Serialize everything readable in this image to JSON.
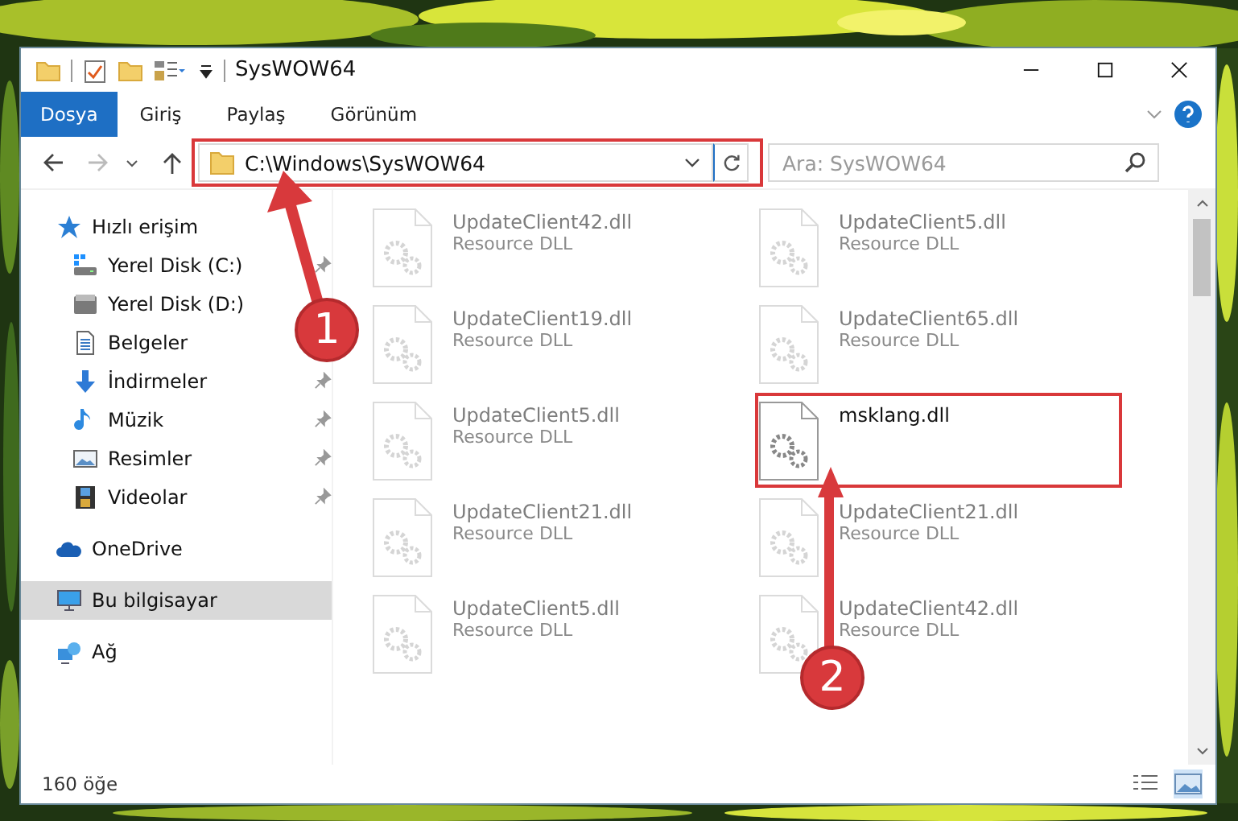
{
  "window": {
    "title": "SysWOW64"
  },
  "ribbon_tabs": [
    {
      "label": "Dosya",
      "selected": true
    },
    {
      "label": "Giriş",
      "selected": false
    },
    {
      "label": "Paylaş",
      "selected": false
    },
    {
      "label": "Görünüm",
      "selected": false
    }
  ],
  "address_bar": {
    "path": "C:\\Windows\\SysWOW64"
  },
  "search": {
    "placeholder": "Ara: SysWOW64"
  },
  "sidebar": {
    "items": [
      {
        "label": "Hızlı erişim",
        "kind": "star",
        "selected": false,
        "children": [
          {
            "label": "Yerel Disk (C:)",
            "kind": "windows-drive",
            "selected": false,
            "pinned": true
          },
          {
            "label": "Yerel Disk (D:)",
            "kind": "drive",
            "selected": false
          },
          {
            "label": "Belgeler",
            "kind": "documents",
            "selected": false
          },
          {
            "label": "İndirmeler",
            "kind": "download",
            "selected": false,
            "pinned": true
          },
          {
            "label": "Müzik",
            "kind": "music",
            "selected": false,
            "pinned": true
          },
          {
            "label": "Resimler",
            "kind": "pictures",
            "selected": false,
            "pinned": true
          },
          {
            "label": "Videolar",
            "kind": "videos",
            "selected": false,
            "pinned": true
          }
        ]
      },
      {
        "label": "OneDrive",
        "kind": "cloud",
        "selected": false
      },
      {
        "label": "Bu bilgisayar",
        "kind": "computer",
        "selected": true
      },
      {
        "label": "Ağ",
        "kind": "network",
        "selected": false
      }
    ]
  },
  "files": [
    {
      "name": "UpdateClient42.dll",
      "type": "Resource DLL",
      "dimmed": true
    },
    {
      "name": "UpdateClient5.dll",
      "type": "Resource DLL",
      "dimmed": true
    },
    {
      "name": "UpdateClient19.dll",
      "type": "Resource DLL",
      "dimmed": true
    },
    {
      "name": "UpdateClient65.dll",
      "type": "Resource DLL",
      "dimmed": true
    },
    {
      "name": "UpdateClient5.dll",
      "type": "Resource DLL",
      "dimmed": true
    },
    {
      "name": "msklang.dll",
      "dimmed": false
    },
    {
      "name": "UpdateClient21.dll",
      "type": "Resource DLL",
      "dimmed": true
    },
    {
      "name": "UpdateClient21.dll",
      "type": "Resource DLL",
      "dimmed": true
    },
    {
      "name": "UpdateClient5.dll",
      "type": "Resource DLL",
      "dimmed": true
    },
    {
      "name": "UpdateClient42.dll",
      "type": "Resource DLL",
      "dimmed": true
    }
  ],
  "status_bar": {
    "item_count": "160 öğe"
  },
  "annotations": [
    {
      "label": "1"
    },
    {
      "label": "2"
    }
  ]
}
